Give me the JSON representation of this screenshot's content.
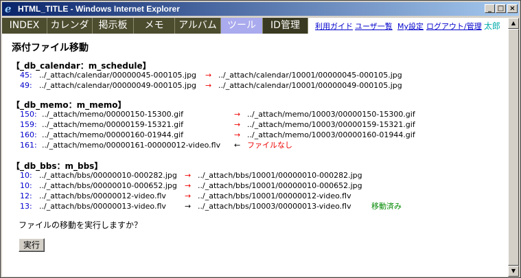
{
  "window": {
    "title": "HTML_TITLE - Windows Internet Explorer"
  },
  "nav": {
    "tabs": [
      {
        "label": "INDEX"
      },
      {
        "label": "カレンダ"
      },
      {
        "label": "掲示板"
      },
      {
        "label": "メモ"
      },
      {
        "label": "アルバム"
      },
      {
        "label": "ツール"
      },
      {
        "label": "ID管理"
      }
    ],
    "active_tab": "ツール",
    "links": {
      "help": "利用ガイド",
      "userlist": "ユーザ一覧",
      "settings": "My設定",
      "logout": "ログアウト/管理"
    },
    "user": "太郎"
  },
  "page": {
    "title": "添付ファイル移動",
    "sections": [
      {
        "title": "【_db_calendar：m_schedule】",
        "rows": [
          {
            "num": "45:",
            "src": "../_attach/calendar/00000045-000105.jpg",
            "arrow": "→",
            "dst": "../_attach/calendar/10001/00000045-000105.jpg",
            "note": ""
          },
          {
            "num": "49:",
            "src": "../_attach/calendar/00000049-000105.jpg",
            "arrow": "→",
            "dst": "../_attach/calendar/10001/00000049-000105.jpg",
            "note": ""
          }
        ]
      },
      {
        "title": "【_db_memo：m_memo】",
        "rows": [
          {
            "num": "150:",
            "src": "../_attach/memo/00000150-15300.gif",
            "arrow": "→",
            "dst": "../_attach/memo/10003/00000150-15300.gif",
            "note": ""
          },
          {
            "num": "159:",
            "src": "../_attach/memo/00000159-15321.gif",
            "arrow": "→",
            "dst": "../_attach/memo/10003/00000159-15321.gif",
            "note": ""
          },
          {
            "num": "160:",
            "src": "../_attach/memo/00000160-01944.gif",
            "arrow": "→",
            "dst": "../_attach/memo/10003/00000160-01944.gif",
            "note": ""
          },
          {
            "num": "161:",
            "src": "../_attach/memo/00000161-00000012-video.flv",
            "arrow": "←",
            "dst": "",
            "note": "ファイルなし"
          }
        ]
      },
      {
        "title": "【_db_bbs：m_bbs】",
        "rows": [
          {
            "num": "10:",
            "src": "../_attach/bbs/00000010-000282.jpg",
            "arrow": "→",
            "dst": "../_attach/bbs/10001/00000010-000282.jpg",
            "note": ""
          },
          {
            "num": "10:",
            "src": "../_attach/bbs/00000010-000652.jpg",
            "arrow": "→",
            "dst": "../_attach/bbs/10001/00000010-000652.jpg",
            "note": ""
          },
          {
            "num": "12:",
            "src": "../_attach/bbs/00000012-video.flv",
            "arrow": "→",
            "dst": "../_attach/bbs/10001/00000012-video.flv",
            "note": ""
          },
          {
            "num": "13:",
            "src": "../_attach/bbs/00000013-video.flv",
            "arrow": "→",
            "dst": "../_attach/bbs/10003/00000013-video.flv",
            "note": "移動済み"
          }
        ]
      }
    ],
    "question": "ファイルの移動を実行しますか？",
    "execute_label": "実行"
  },
  "colors": {
    "accent_red": "#ee0000",
    "moved_green": "#008800",
    "link_blue": "#0000cc",
    "nav_bg": "#4c4c2f",
    "active_tab": "#aaaaee"
  }
}
